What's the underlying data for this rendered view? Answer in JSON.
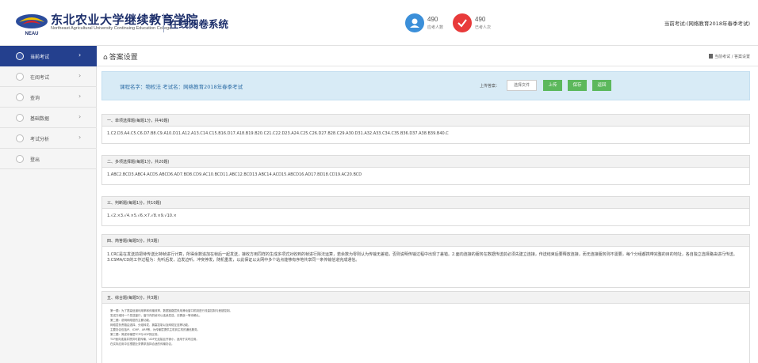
{
  "header": {
    "brand_cn": "东北农业大学继续教育学院",
    "brand_en": "Northeast Agricultural University Continuing Education College",
    "system_name": "在线阅卷系统",
    "stats": [
      {
        "value": "490",
        "label": "应考人数",
        "color": "#3b8fd9"
      },
      {
        "value": "490",
        "label": "已考人次",
        "color": "#e83a3a"
      }
    ],
    "current_exam": "当前考试:(网络教育2018年春季考试)"
  },
  "sidebar": {
    "items": [
      {
        "label": "当前考试",
        "active": true
      },
      {
        "label": "在阅考试"
      },
      {
        "label": "查询"
      },
      {
        "label": "基础数据"
      },
      {
        "label": "考试分析"
      },
      {
        "label": "登出"
      }
    ]
  },
  "page": {
    "title": "答案设置",
    "breadcrumb": "当前考试 / 答案设置"
  },
  "infobar": {
    "course": "课程名字：物权法    考试名：网络教育2018年春季考试",
    "upload_label": "上传答案：",
    "file_button": "选择文件",
    "btn_upload": "上传",
    "btn_save": "保存",
    "btn_back": "返回"
  },
  "sections": [
    {
      "title": "一、单项选择题(每题1分，共40题)",
      "content": "1.C2.D3.A4.C5.C6.D7.B8.C9.A10.D11.A12.A13.C14.C15.B16.D17.A18.B19.B20.C21.C22.D23.A24.C25.C26.D27.B28.C29.A30.D31.A32.A33.C34.C35.B36.D37.A38.B39.B40.C"
    },
    {
      "title": "二、多项选择题(每题1分，共20题)",
      "content": "1.ABC2.BCD3.ABC4.ACD5.ABCD6.AD7.BD8.CD9.AC10.BCD11.ABC12.BCD13.ABC14.ACD15.ABCD16.AD17.BD18.CD19.AC20.BCD"
    },
    {
      "title": "三、判断题(每题1分，共10题)",
      "content": "1.√2.×3.√4.×5.√6.×7.√8.×9.√10.×"
    },
    {
      "title": "四、简答题(每题5分，共3题)",
      "content": "1.CRC是在发送前把待传送比特帧进行计算，所得余数追加在帧后一起发送，接收方用同样的生成多项式对收到的帧进行除法运算，若余数为零则认为传输无差错，否则说明传输过程中出现了差错。2.面向连接的服务在数据传送前必须先建立连接，传送结束后要释放连接，而无连接服务则不需要，每个分组都携带完整的目的地址，各自独立选择路由进行传送。3.CSMA/CD的工作过程为：先听后发，边发边听，冲突停发，随机重发，以此保证以太网中多个站点能够有序地共享同一条传输信道完成通信。"
    },
    {
      "title": "五、综合题(每题5分，共3题)",
      "essay": [
        "第一题：为了提高信道利用率和传输效率，数据链路层采用滑动窗口机制进行流量控制与差错控制。",
        "发送方维持一个发送窗口，窗口内的帧可以连续发送，无需逐一等待确认。",
        "第二题：说明网络层的主要功能。",
        "网络层负责路由选择、分组转发、拥塞控制以及网络互连等功能。",
        "主要协议包括IP、ICMP、ARP等，为传输层提供主机到主机的通信服务。",
        "第三题：简述传输层TCP与UDP的区别。",
        "TCP面向连接并提供可靠传输，UDP无连接且开销小，适用于实时应用。",
        "在实际应用中应根据业务需求选择合适的传输协议。"
      ]
    }
  ]
}
